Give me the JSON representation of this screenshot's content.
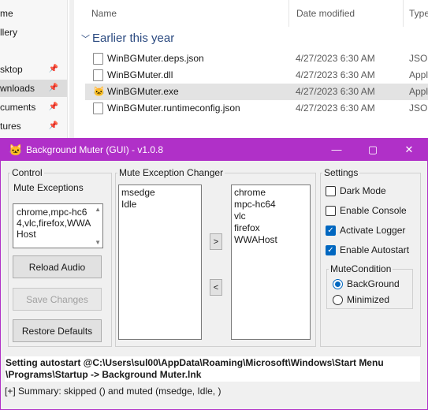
{
  "explorer": {
    "nav": [
      {
        "label": "me",
        "pinned": false
      },
      {
        "label": "llery",
        "pinned": false
      },
      {
        "label": "sktop",
        "pinned": true
      },
      {
        "label": "wnloads",
        "pinned": true,
        "selected": true
      },
      {
        "label": "cuments",
        "pinned": true
      },
      {
        "label": "tures",
        "pinned": true
      }
    ],
    "columns": {
      "name": "Name",
      "date": "Date modified",
      "type": "Type"
    },
    "group_label": "Earlier this year",
    "files": [
      {
        "name": "WinBGMuter.deps.json",
        "date": "4/27/2023 6:30 AM",
        "type": "JSON",
        "icon": "file-icon"
      },
      {
        "name": "WinBGMuter.dll",
        "date": "4/27/2023 6:30 AM",
        "type": "Appl",
        "icon": "file-icon"
      },
      {
        "name": "WinBGMuter.exe",
        "date": "4/27/2023 6:30 AM",
        "type": "Appl",
        "icon": "app-exe-icon",
        "selected": true
      },
      {
        "name": "WinBGMuter.runtimeconfig.json",
        "date": "4/27/2023 6:30 AM",
        "type": "JSON",
        "icon": "file-icon"
      }
    ]
  },
  "app": {
    "title": "Background Muter (GUI) - v1.0.8",
    "title_color": "#b030c8",
    "control": {
      "legend": "Control",
      "mute_exceptions_label": "Mute Exceptions",
      "mute_exceptions_value": "chrome,mpc-hc64,vlc,firefox,WWAHost",
      "reload_audio": "Reload Audio",
      "save_changes": "Save Changes",
      "restore_defaults": "Restore Defaults"
    },
    "changer": {
      "legend": "Mute Exception Changer",
      "left_list": [
        "msedge",
        "Idle"
      ],
      "right_list": [
        "chrome",
        "mpc-hc64",
        "vlc",
        "firefox",
        "WWAHost"
      ],
      "move_right": ">",
      "move_left": "<"
    },
    "settings": {
      "legend": "Settings",
      "options": [
        {
          "label": "Dark Mode",
          "checked": false
        },
        {
          "label": "Enable Console",
          "checked": false
        },
        {
          "label": "Activate Logger",
          "checked": true
        },
        {
          "label": "Enable Autostart",
          "checked": true
        }
      ],
      "mute_condition": {
        "legend": "MuteCondition",
        "options": [
          {
            "label": "BackGround",
            "selected": true
          },
          {
            "label": "Minimized",
            "selected": false
          }
        ]
      }
    },
    "log_line1": "Setting autostart @C:\\Users\\sul00\\AppData\\Roaming\\Microsoft\\Windows\\Start Menu",
    "log_line2": "\\Programs\\Startup -> Background Muter.lnk",
    "summary": "[+] Summary: skipped () and muted (msedge, Idle, )"
  }
}
